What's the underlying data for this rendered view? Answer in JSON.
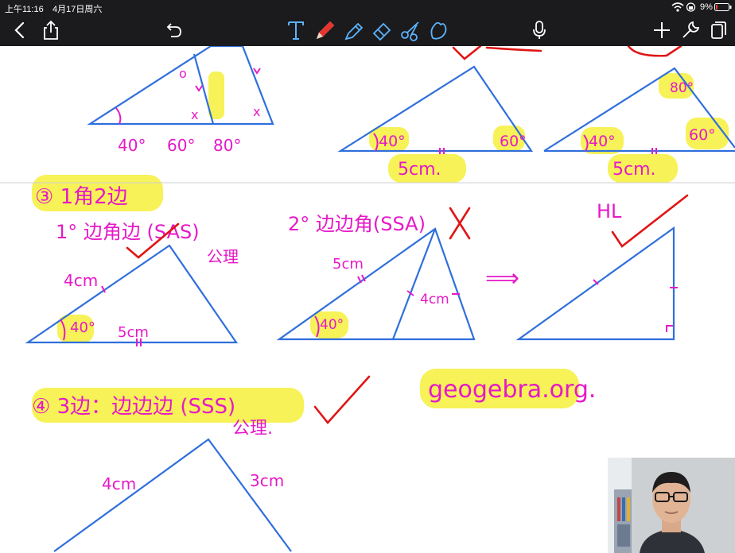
{
  "status": {
    "time": "上午11:16",
    "date": "4月17日周六",
    "battery": "9%"
  },
  "toolbar": {
    "tools": [
      "back",
      "share",
      "undo",
      "text",
      "pen",
      "highlighter",
      "eraser",
      "scissors",
      "lasso",
      "microphone",
      "add",
      "settings",
      "pages"
    ]
  },
  "colors": {
    "bar": "#1b1b1d",
    "ink": "#e619c8",
    "blue": "#2f6fdc",
    "red": "#e01515",
    "highlight": "#f6f03a"
  },
  "notes": {
    "top": {
      "angles": [
        "40°",
        "60°",
        "80°"
      ],
      "mark_o": "o",
      "mark_x1": "x",
      "mark_x2": "x",
      "tri2_angle1": "40°",
      "tri2_angle2": "60°",
      "tri2_side": "5cm.",
      "tri3_angle1": "40°",
      "tri3_angle2": "60°",
      "tri3_top": "80°",
      "tri3_side": "5cm."
    },
    "case3": {
      "heading": "③ 1角2边",
      "sas": "1° 边角边 (SAS)",
      "sas_axiom": "公理",
      "sas_side1": "4cm",
      "sas_angle": "40°",
      "sas_side2": "5cm",
      "ssa": "2° 边边角(SSA)",
      "ssa_side": "5cm",
      "ssa_angle": "40°",
      "ssa_len": "4cm",
      "arrow": "⟹",
      "hl": "HL"
    },
    "case4": {
      "heading": "④ 3边：边边边 (SSS)",
      "axiom": "公理.",
      "side1": "4cm",
      "side2": "3cm",
      "link": "geogebra.org."
    }
  }
}
